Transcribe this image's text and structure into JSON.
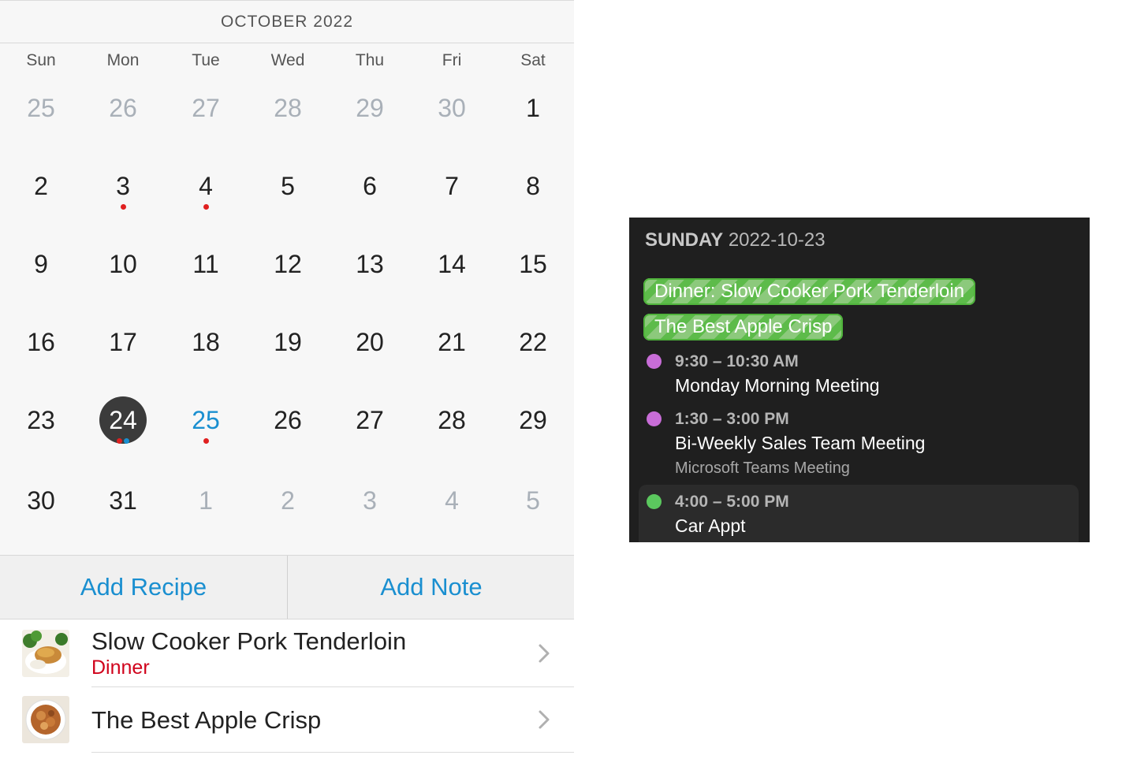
{
  "calendar": {
    "month_label": "OCTOBER 2022",
    "weekdays": [
      "Sun",
      "Mon",
      "Tue",
      "Wed",
      "Thu",
      "Fri",
      "Sat"
    ],
    "weeks": [
      [
        {
          "d": "25",
          "other": true
        },
        {
          "d": "26",
          "other": true
        },
        {
          "d": "27",
          "other": true
        },
        {
          "d": "28",
          "other": true
        },
        {
          "d": "29",
          "other": true
        },
        {
          "d": "30",
          "other": true
        },
        {
          "d": "1"
        }
      ],
      [
        {
          "d": "2"
        },
        {
          "d": "3",
          "dots": [
            "#e02020"
          ]
        },
        {
          "d": "4",
          "dots": [
            "#e02020"
          ]
        },
        {
          "d": "5"
        },
        {
          "d": "6"
        },
        {
          "d": "7"
        },
        {
          "d": "8"
        }
      ],
      [
        {
          "d": "9"
        },
        {
          "d": "10"
        },
        {
          "d": "11"
        },
        {
          "d": "12"
        },
        {
          "d": "13"
        },
        {
          "d": "14"
        },
        {
          "d": "15"
        }
      ],
      [
        {
          "d": "16"
        },
        {
          "d": "17"
        },
        {
          "d": "18"
        },
        {
          "d": "19"
        },
        {
          "d": "20"
        },
        {
          "d": "21"
        },
        {
          "d": "22"
        }
      ],
      [
        {
          "d": "23"
        },
        {
          "d": "24",
          "today": true,
          "dots": [
            "#e02020",
            "#1a8fd0"
          ]
        },
        {
          "d": "25",
          "selected": true,
          "dots": [
            "#e02020"
          ]
        },
        {
          "d": "26"
        },
        {
          "d": "27"
        },
        {
          "d": "28"
        },
        {
          "d": "29"
        }
      ],
      [
        {
          "d": "30"
        },
        {
          "d": "31"
        },
        {
          "d": "1",
          "other": true
        },
        {
          "d": "2",
          "other": true
        },
        {
          "d": "3",
          "other": true
        },
        {
          "d": "4",
          "other": true
        },
        {
          "d": "5",
          "other": true
        }
      ]
    ],
    "accent_color": "#1a8fd0",
    "dot_colors": {
      "dinner": "#e02020",
      "note": "#1a8fd0"
    }
  },
  "actions": {
    "add_recipe": "Add Recipe",
    "add_note": "Add Note"
  },
  "recipes": [
    {
      "title": "Slow Cooker Pork Tenderloin",
      "meal": "Dinner",
      "thumb": "pork-tenderloin-photo"
    },
    {
      "title": "The Best Apple Crisp",
      "meal": "",
      "thumb": "apple-crisp-photo"
    }
  ],
  "day_view": {
    "weekday": "SUNDAY",
    "date": "2022-10-23",
    "all_day_events": [
      "Dinner: Slow Cooker Pork Tenderloin",
      "The Best Apple Crisp"
    ],
    "events": [
      {
        "time": "9:30 – 10:30 AM",
        "title": "Monday Morning Meeting",
        "subtitle": "",
        "color": "#c86dd7"
      },
      {
        "time": "1:30 – 3:00 PM",
        "title": "Bi-Weekly Sales Team Meeting",
        "subtitle": "Microsoft Teams Meeting",
        "color": "#c86dd7"
      },
      {
        "time": "4:00 – 5:00 PM",
        "title": "Car Appt",
        "subtitle": "",
        "color": "#5bc85e"
      }
    ]
  }
}
